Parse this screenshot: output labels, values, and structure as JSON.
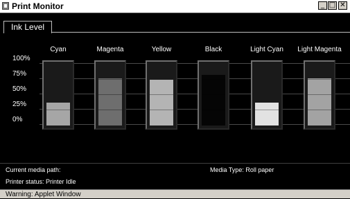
{
  "window": {
    "title": "Print Monitor"
  },
  "window_buttons": {
    "minimize": "_",
    "maximize": "□",
    "close": "✕"
  },
  "tabs": [
    {
      "label": "Ink Level"
    }
  ],
  "ink_level": {
    "scale": [
      "100%",
      "75%",
      "50%",
      "25%",
      "0%"
    ],
    "cartridges": [
      {
        "name": "Cyan",
        "level": 0.38,
        "color": "#a6a6a6"
      },
      {
        "name": "Magenta",
        "level": 0.77,
        "color": "#6e6e6e"
      },
      {
        "name": "Yellow",
        "level": 0.75,
        "color": "#b4b4b4"
      },
      {
        "name": "Black",
        "level": 0.83,
        "color": "#050505"
      },
      {
        "name": "Light Cyan",
        "level": 0.38,
        "color": "#e2e2e2"
      },
      {
        "name": "Light Magenta",
        "level": 0.77,
        "color": "#a3a3a3"
      }
    ]
  },
  "status": {
    "media_path_label": "Current media path:",
    "printer_status": "Printer status: Printer Idle",
    "media_type": "Media Type: Roll paper"
  },
  "warning": "Warning: Applet Window"
}
